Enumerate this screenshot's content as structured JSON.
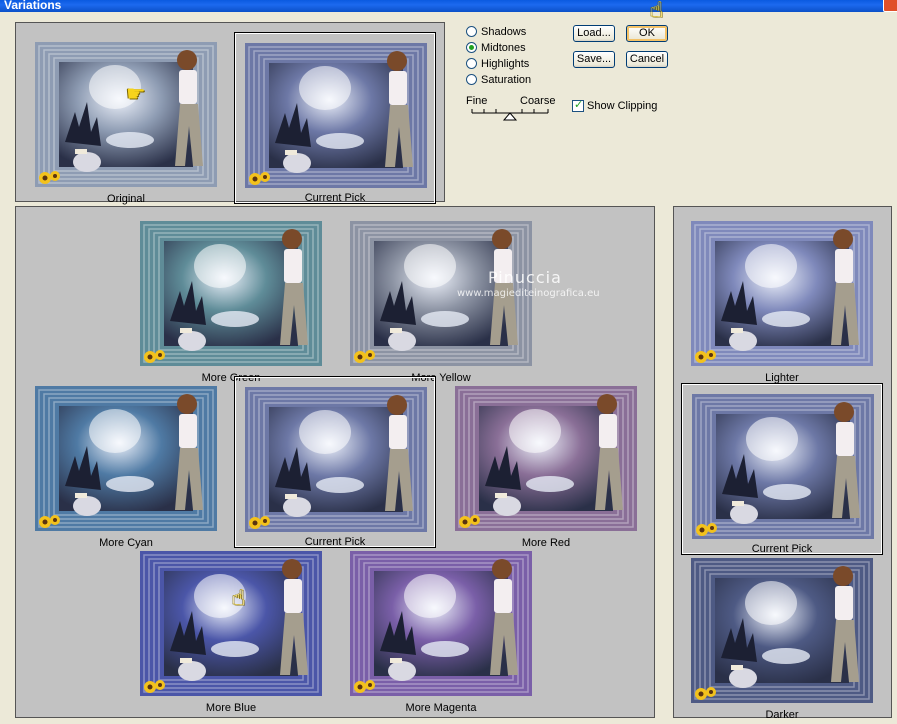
{
  "window": {
    "title": "Variations"
  },
  "modes": [
    {
      "label": "Shadows",
      "selected": false
    },
    {
      "label": "Midtones",
      "selected": true
    },
    {
      "label": "Highlights",
      "selected": false
    },
    {
      "label": "Saturation",
      "selected": false
    }
  ],
  "buttons": {
    "load": "Load...",
    "save": "Save...",
    "ok": "OK",
    "cancel": "Cancel"
  },
  "slider": {
    "fine": "Fine",
    "coarse": "Coarse"
  },
  "show_clipping": {
    "label": "Show Clipping",
    "checked": true
  },
  "thumbnails": {
    "original": {
      "caption": "Original",
      "tint": "#8e9cb3"
    },
    "top_current": {
      "caption": "Current Pick",
      "tint": "#6d78a6"
    },
    "more_green": {
      "caption": "More Green",
      "tint": "#5f8c98"
    },
    "more_yellow": {
      "caption": "More Yellow",
      "tint": "#8c93a3"
    },
    "more_cyan": {
      "caption": "More Cyan",
      "tint": "#4f7aa4"
    },
    "center_current": {
      "caption": "Current Pick",
      "tint": "#6d78a6"
    },
    "more_red": {
      "caption": "More Red",
      "tint": "#8a6f97"
    },
    "more_blue": {
      "caption": "More Blue",
      "tint": "#4b56a8"
    },
    "more_magenta": {
      "caption": "More Magenta",
      "tint": "#7a5fa8"
    },
    "lighter": {
      "caption": "Lighter",
      "tint": "#7f89bb"
    },
    "right_current": {
      "caption": "Current Pick",
      "tint": "#6d78a6"
    },
    "darker": {
      "caption": "Darker",
      "tint": "#4e5a84"
    }
  },
  "watermark": {
    "name": "Pinuccia",
    "url": "www.magiediteinografica.eu"
  }
}
